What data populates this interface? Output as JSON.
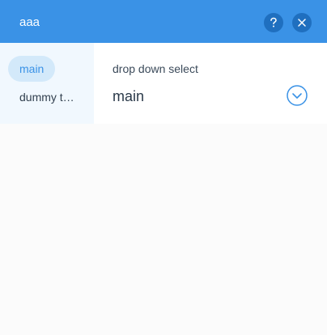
{
  "header": {
    "title": "aaa",
    "help_label": "?",
    "close_label": "×"
  },
  "sidebar": {
    "items": [
      {
        "label": "main",
        "active": true
      },
      {
        "label": "dummy t…",
        "active": false
      }
    ]
  },
  "main": {
    "field_label": "drop down select",
    "select_value": "main"
  },
  "colors": {
    "accent": "#3a92e6",
    "header_button": "#1f6fbf",
    "sidebar_bg": "#f1f8fe",
    "active_pill": "#d3e9fa"
  }
}
